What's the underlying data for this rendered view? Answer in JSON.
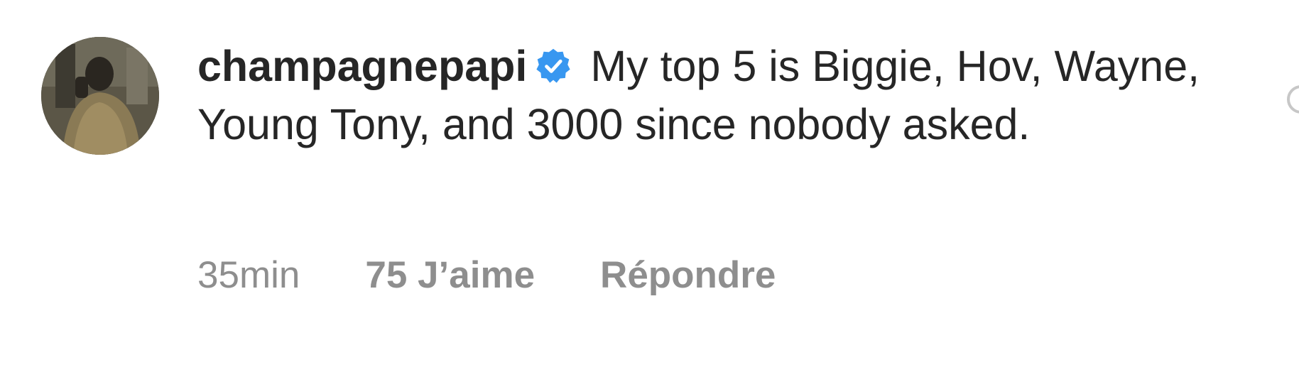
{
  "comment": {
    "username": "champagnepapi",
    "verified_icon": "verified-badge-icon",
    "text": "My top 5 is Biggie, Hov, Wayne, Young Tony, and 3000 since nobody asked.",
    "timestamp": "35min",
    "likes_label": "75 J’aime",
    "reply_label": "Répondre"
  },
  "colors": {
    "text": "#262626",
    "meta": "#8e8e8e",
    "verified": "#3897f0"
  }
}
